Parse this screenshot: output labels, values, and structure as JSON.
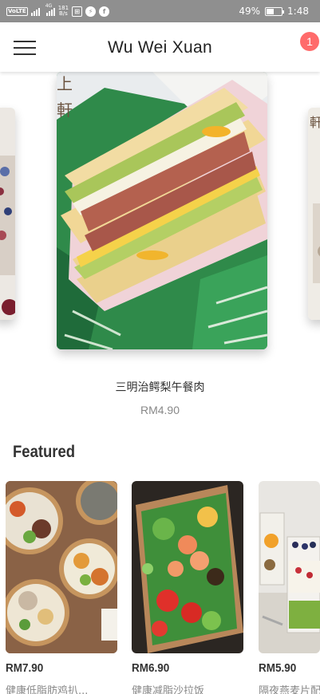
{
  "status_bar": {
    "volte": "VoLTE",
    "network": "4G",
    "speed_value": "181",
    "speed_unit": "B/s",
    "battery_percent": "49%",
    "time": "1:48",
    "battery_level": 0.49
  },
  "header": {
    "title": "Wu Wei Xuan",
    "cart_count": "1"
  },
  "carousel": {
    "current": {
      "name": "三明治鳄梨午餐肉",
      "price": "RM4.90"
    }
  },
  "featured": {
    "title": "Featured",
    "items": [
      {
        "price": "RM7.90",
        "name": "健康低脂肪鸡扒..."
      },
      {
        "price": "RM6.90",
        "name": "健康减脂沙拉饭"
      },
      {
        "price": "RM5.90",
        "name": "隔夜燕麦片配..."
      }
    ]
  },
  "colors": {
    "status_bar": "#8f8f8f",
    "badge": "#ff6b6b",
    "text_primary": "#333333",
    "text_secondary": "#888888"
  }
}
